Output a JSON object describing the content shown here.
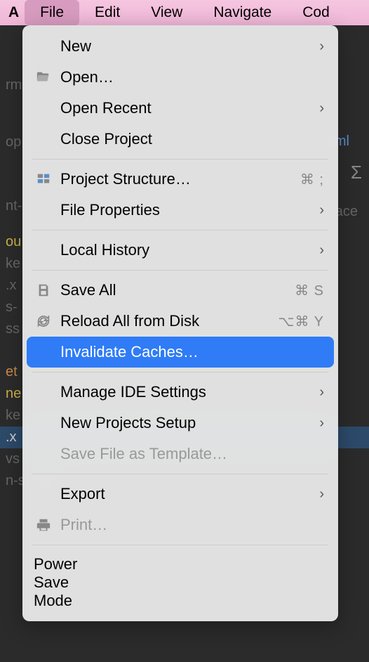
{
  "menubar": {
    "logo": "A",
    "items": [
      "File",
      "Edit",
      "View",
      "Navigate",
      "Cod"
    ]
  },
  "dropdown": {
    "items": [
      {
        "label": "New",
        "submenu": true
      },
      {
        "label": "Open…",
        "icon": "folder-open-icon"
      },
      {
        "label": "Open Recent",
        "submenu": true
      },
      {
        "label": "Close Project"
      },
      {
        "sep": true
      },
      {
        "label": "Project Structure…",
        "icon": "project-structure-icon",
        "shortcut": "⌘ ;"
      },
      {
        "label": "File Properties",
        "submenu": true
      },
      {
        "sep": true
      },
      {
        "label": "Local History",
        "submenu": true
      },
      {
        "sep": true
      },
      {
        "label": "Save All",
        "icon": "save-icon",
        "shortcut": "⌘ S"
      },
      {
        "label": "Reload All from Disk",
        "icon": "reload-icon",
        "shortcut": "⌥⌘ Y"
      },
      {
        "label": "Invalidate Caches…",
        "highlighted": true
      },
      {
        "sep": true
      },
      {
        "label": "Manage IDE Settings",
        "submenu": true
      },
      {
        "label": "New Projects Setup",
        "submenu": true
      },
      {
        "label": "Save File as Template…",
        "disabled": true
      },
      {
        "sep": true
      },
      {
        "label": "Export",
        "submenu": true
      },
      {
        "label": "Print…",
        "icon": "print-icon",
        "disabled": true
      },
      {
        "sep": true
      },
      {
        "label": "Power Save Mode"
      }
    ]
  },
  "background": {
    "lines": [
      {
        "text": "rm",
        "class": ""
      },
      {
        "text": "",
        "class": ""
      },
      {
        "text": "op",
        "class": ""
      },
      {
        "text": "",
        "class": ""
      },
      {
        "text": "nt-",
        "class": ""
      },
      {
        "text": "ou",
        "class": "yellow"
      },
      {
        "text": "ke",
        "class": ""
      },
      {
        "text": ".x",
        "class": ""
      },
      {
        "text": "s-",
        "class": ""
      },
      {
        "text": "ss",
        "class": ""
      },
      {
        "text": "et",
        "class": "orange"
      },
      {
        "text": "ne",
        "class": "yellow"
      },
      {
        "text": "ke",
        "class": ""
      },
      {
        "text": ".x",
        "class": "blue"
      },
      {
        "text": "vs",
        "class": ""
      },
      {
        "text": "n-service",
        "class": ""
      }
    ],
    "xml": "xml",
    "ace": "ace"
  }
}
